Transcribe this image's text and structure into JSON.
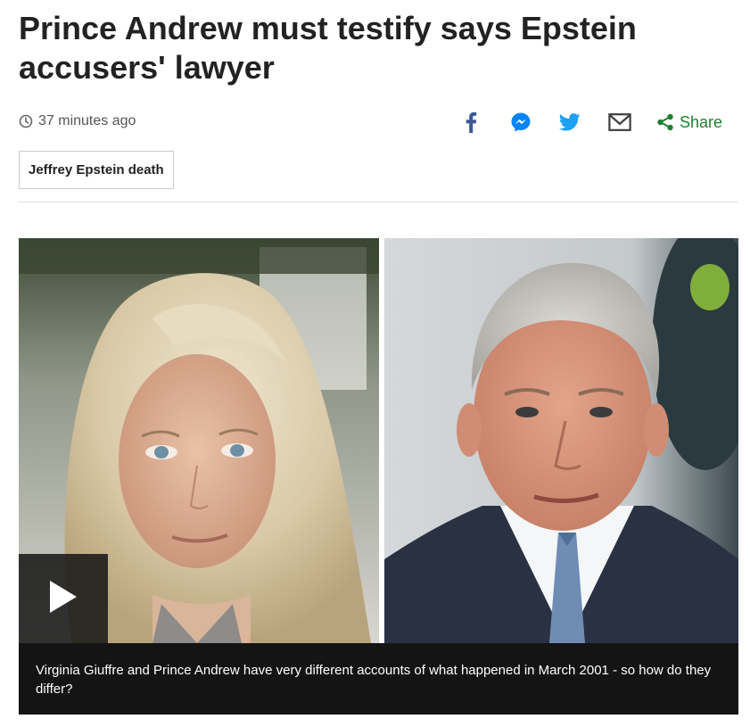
{
  "article": {
    "headline": "Prince Andrew must testify says Epstein accusers' lawyer",
    "timestamp": "37 minutes ago",
    "topic_tag": "Jeffrey Epstein death"
  },
  "share": {
    "label": "Share",
    "icons": [
      "facebook-icon",
      "messenger-icon",
      "twitter-icon",
      "email-icon",
      "share-icon"
    ],
    "colors": {
      "facebook": "#3b5998",
      "messenger": "#0084ff",
      "twitter": "#1da1f2",
      "email": "#404040",
      "share": "#1e8032"
    }
  },
  "media": {
    "caption": "Virginia Giuffre and Prince Andrew have very different accounts of what happened in March 2001 - so how do they differ?",
    "play_icon": "play-icon"
  }
}
